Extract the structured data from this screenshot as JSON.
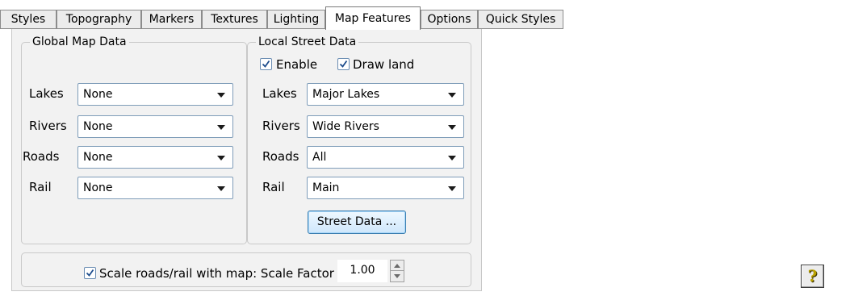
{
  "tabs": [
    {
      "label": "Styles"
    },
    {
      "label": "Topography"
    },
    {
      "label": "Markers"
    },
    {
      "label": "Textures"
    },
    {
      "label": "Lighting"
    },
    {
      "label": "Map Features",
      "active": true
    },
    {
      "label": "Options"
    },
    {
      "label": "Quick Styles"
    }
  ],
  "global_map_data": {
    "title": "Global Map Data",
    "rows": [
      {
        "label": "Lakes",
        "value": "None"
      },
      {
        "label": "Rivers",
        "value": "None"
      },
      {
        "label": "Roads",
        "value": "None"
      },
      {
        "label": "Rail",
        "value": "None"
      }
    ]
  },
  "local_street_data": {
    "title": "Local Street Data",
    "enable": {
      "label": "Enable",
      "checked": true
    },
    "draw_land": {
      "label": "Draw land",
      "checked": true
    },
    "rows": [
      {
        "label": "Lakes",
        "value": "Major Lakes"
      },
      {
        "label": "Rivers",
        "value": "Wide Rivers"
      },
      {
        "label": "Roads",
        "value": "All"
      },
      {
        "label": "Rail",
        "value": "Main"
      }
    ],
    "street_data_button": "Street Data ..."
  },
  "scale": {
    "checkbox_label": "Scale roads/rail with map: Scale Factor",
    "checked": true,
    "value": "1.00"
  },
  "help": {
    "icon": "question-mark-icon",
    "glyph": "?"
  },
  "colors": {
    "accent_button": "#cfe7fb",
    "help_glyph": "#b8a000",
    "panel_bg": "#f2f2f2"
  }
}
